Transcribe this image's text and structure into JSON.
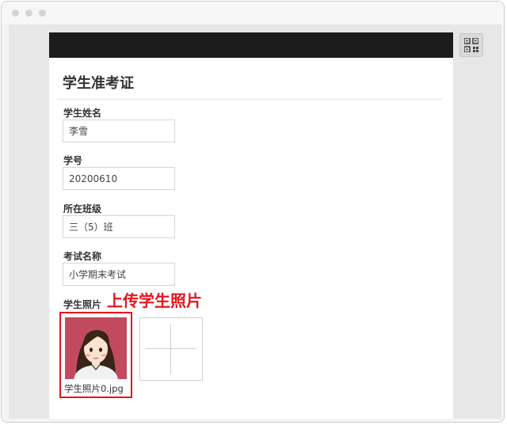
{
  "page": {
    "title": "学生准考证"
  },
  "fields": [
    {
      "label": "学生姓名",
      "value": "李雪"
    },
    {
      "label": "学号",
      "value": "20200610"
    },
    {
      "label": "所在班级",
      "value": "三（5）班"
    },
    {
      "label": "考试名称",
      "value": "小学期末考试"
    }
  ],
  "photo": {
    "label": "学生照片",
    "annotation": "上传学生照片",
    "file_name": "学生照片0.jpg"
  },
  "icons": {
    "qr_button": "qr-code-icon",
    "upload": "plus-icon"
  },
  "colors": {
    "topbar": "#1c1c1c",
    "annotation_red": "#e8141b",
    "photo_background": "#c24a5f"
  }
}
